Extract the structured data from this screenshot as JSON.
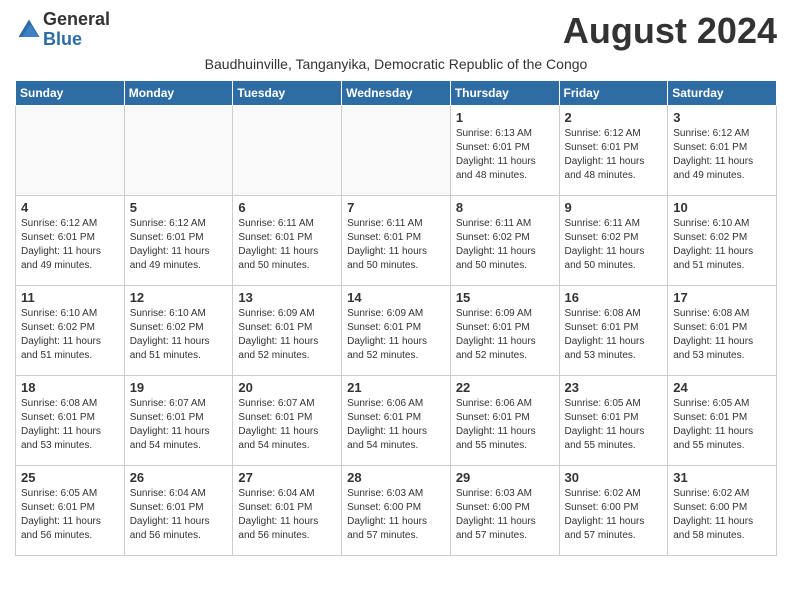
{
  "header": {
    "logo_general": "General",
    "logo_blue": "Blue",
    "month_title": "August 2024",
    "subtitle": "Baudhuinville, Tanganyika, Democratic Republic of the Congo"
  },
  "days_of_week": [
    "Sunday",
    "Monday",
    "Tuesday",
    "Wednesday",
    "Thursday",
    "Friday",
    "Saturday"
  ],
  "weeks": [
    [
      {
        "day": "",
        "info": ""
      },
      {
        "day": "",
        "info": ""
      },
      {
        "day": "",
        "info": ""
      },
      {
        "day": "",
        "info": ""
      },
      {
        "day": "1",
        "info": "Sunrise: 6:13 AM\nSunset: 6:01 PM\nDaylight: 11 hours and 48 minutes."
      },
      {
        "day": "2",
        "info": "Sunrise: 6:12 AM\nSunset: 6:01 PM\nDaylight: 11 hours and 48 minutes."
      },
      {
        "day": "3",
        "info": "Sunrise: 6:12 AM\nSunset: 6:01 PM\nDaylight: 11 hours and 49 minutes."
      }
    ],
    [
      {
        "day": "4",
        "info": "Sunrise: 6:12 AM\nSunset: 6:01 PM\nDaylight: 11 hours and 49 minutes."
      },
      {
        "day": "5",
        "info": "Sunrise: 6:12 AM\nSunset: 6:01 PM\nDaylight: 11 hours and 49 minutes."
      },
      {
        "day": "6",
        "info": "Sunrise: 6:11 AM\nSunset: 6:01 PM\nDaylight: 11 hours and 50 minutes."
      },
      {
        "day": "7",
        "info": "Sunrise: 6:11 AM\nSunset: 6:01 PM\nDaylight: 11 hours and 50 minutes."
      },
      {
        "day": "8",
        "info": "Sunrise: 6:11 AM\nSunset: 6:02 PM\nDaylight: 11 hours and 50 minutes."
      },
      {
        "day": "9",
        "info": "Sunrise: 6:11 AM\nSunset: 6:02 PM\nDaylight: 11 hours and 50 minutes."
      },
      {
        "day": "10",
        "info": "Sunrise: 6:10 AM\nSunset: 6:02 PM\nDaylight: 11 hours and 51 minutes."
      }
    ],
    [
      {
        "day": "11",
        "info": "Sunrise: 6:10 AM\nSunset: 6:02 PM\nDaylight: 11 hours and 51 minutes."
      },
      {
        "day": "12",
        "info": "Sunrise: 6:10 AM\nSunset: 6:02 PM\nDaylight: 11 hours and 51 minutes."
      },
      {
        "day": "13",
        "info": "Sunrise: 6:09 AM\nSunset: 6:01 PM\nDaylight: 11 hours and 52 minutes."
      },
      {
        "day": "14",
        "info": "Sunrise: 6:09 AM\nSunset: 6:01 PM\nDaylight: 11 hours and 52 minutes."
      },
      {
        "day": "15",
        "info": "Sunrise: 6:09 AM\nSunset: 6:01 PM\nDaylight: 11 hours and 52 minutes."
      },
      {
        "day": "16",
        "info": "Sunrise: 6:08 AM\nSunset: 6:01 PM\nDaylight: 11 hours and 53 minutes."
      },
      {
        "day": "17",
        "info": "Sunrise: 6:08 AM\nSunset: 6:01 PM\nDaylight: 11 hours and 53 minutes."
      }
    ],
    [
      {
        "day": "18",
        "info": "Sunrise: 6:08 AM\nSunset: 6:01 PM\nDaylight: 11 hours and 53 minutes."
      },
      {
        "day": "19",
        "info": "Sunrise: 6:07 AM\nSunset: 6:01 PM\nDaylight: 11 hours and 54 minutes."
      },
      {
        "day": "20",
        "info": "Sunrise: 6:07 AM\nSunset: 6:01 PM\nDaylight: 11 hours and 54 minutes."
      },
      {
        "day": "21",
        "info": "Sunrise: 6:06 AM\nSunset: 6:01 PM\nDaylight: 11 hours and 54 minutes."
      },
      {
        "day": "22",
        "info": "Sunrise: 6:06 AM\nSunset: 6:01 PM\nDaylight: 11 hours and 55 minutes."
      },
      {
        "day": "23",
        "info": "Sunrise: 6:05 AM\nSunset: 6:01 PM\nDaylight: 11 hours and 55 minutes."
      },
      {
        "day": "24",
        "info": "Sunrise: 6:05 AM\nSunset: 6:01 PM\nDaylight: 11 hours and 55 minutes."
      }
    ],
    [
      {
        "day": "25",
        "info": "Sunrise: 6:05 AM\nSunset: 6:01 PM\nDaylight: 11 hours and 56 minutes."
      },
      {
        "day": "26",
        "info": "Sunrise: 6:04 AM\nSunset: 6:01 PM\nDaylight: 11 hours and 56 minutes."
      },
      {
        "day": "27",
        "info": "Sunrise: 6:04 AM\nSunset: 6:01 PM\nDaylight: 11 hours and 56 minutes."
      },
      {
        "day": "28",
        "info": "Sunrise: 6:03 AM\nSunset: 6:00 PM\nDaylight: 11 hours and 57 minutes."
      },
      {
        "day": "29",
        "info": "Sunrise: 6:03 AM\nSunset: 6:00 PM\nDaylight: 11 hours and 57 minutes."
      },
      {
        "day": "30",
        "info": "Sunrise: 6:02 AM\nSunset: 6:00 PM\nDaylight: 11 hours and 57 minutes."
      },
      {
        "day": "31",
        "info": "Sunrise: 6:02 AM\nSunset: 6:00 PM\nDaylight: 11 hours and 58 minutes."
      }
    ]
  ]
}
